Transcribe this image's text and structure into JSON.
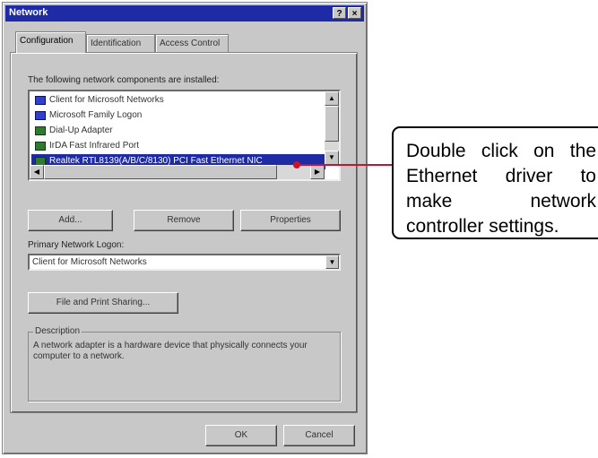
{
  "window": {
    "title": "Network",
    "help_glyph": "?",
    "close_glyph": "×"
  },
  "tabs": [
    {
      "label": "Configuration",
      "active": true
    },
    {
      "label": "Identification",
      "active": false
    },
    {
      "label": "Access Control",
      "active": false
    }
  ],
  "components": {
    "label": "The following network components are installed:",
    "items": [
      {
        "label": "Client for Microsoft Networks",
        "icon": "client-icon",
        "selected": false
      },
      {
        "label": "Microsoft Family Logon",
        "icon": "client-icon",
        "selected": false
      },
      {
        "label": "Dial-Up Adapter",
        "icon": "adapter-icon",
        "selected": false
      },
      {
        "label": "IrDA Fast Infrared Port",
        "icon": "adapter-icon",
        "selected": false
      },
      {
        "label": "Realtek RTL8139(A/B/C/8130) PCI Fast Ethernet NIC",
        "icon": "adapter-icon",
        "selected": true
      }
    ]
  },
  "buttons": {
    "add": "Add...",
    "remove": "Remove",
    "properties": "Properties"
  },
  "logon": {
    "label": "Primary Network Logon:",
    "value": "Client for Microsoft Networks"
  },
  "file_print_button": "File and Print Sharing...",
  "description": {
    "legend": "Description",
    "text": "A network adapter is a hardware device that physically connects your computer to a network."
  },
  "footer": {
    "ok": "OK",
    "cancel": "Cancel"
  },
  "callout": {
    "text": "Double click on the Ethernet driver to make network controller settings."
  },
  "colors": {
    "title_bar": "#1e2ba4",
    "selection": "#1e2ba4",
    "connector_line": "#d0102a",
    "dialog_face": "#c8c8c8"
  }
}
